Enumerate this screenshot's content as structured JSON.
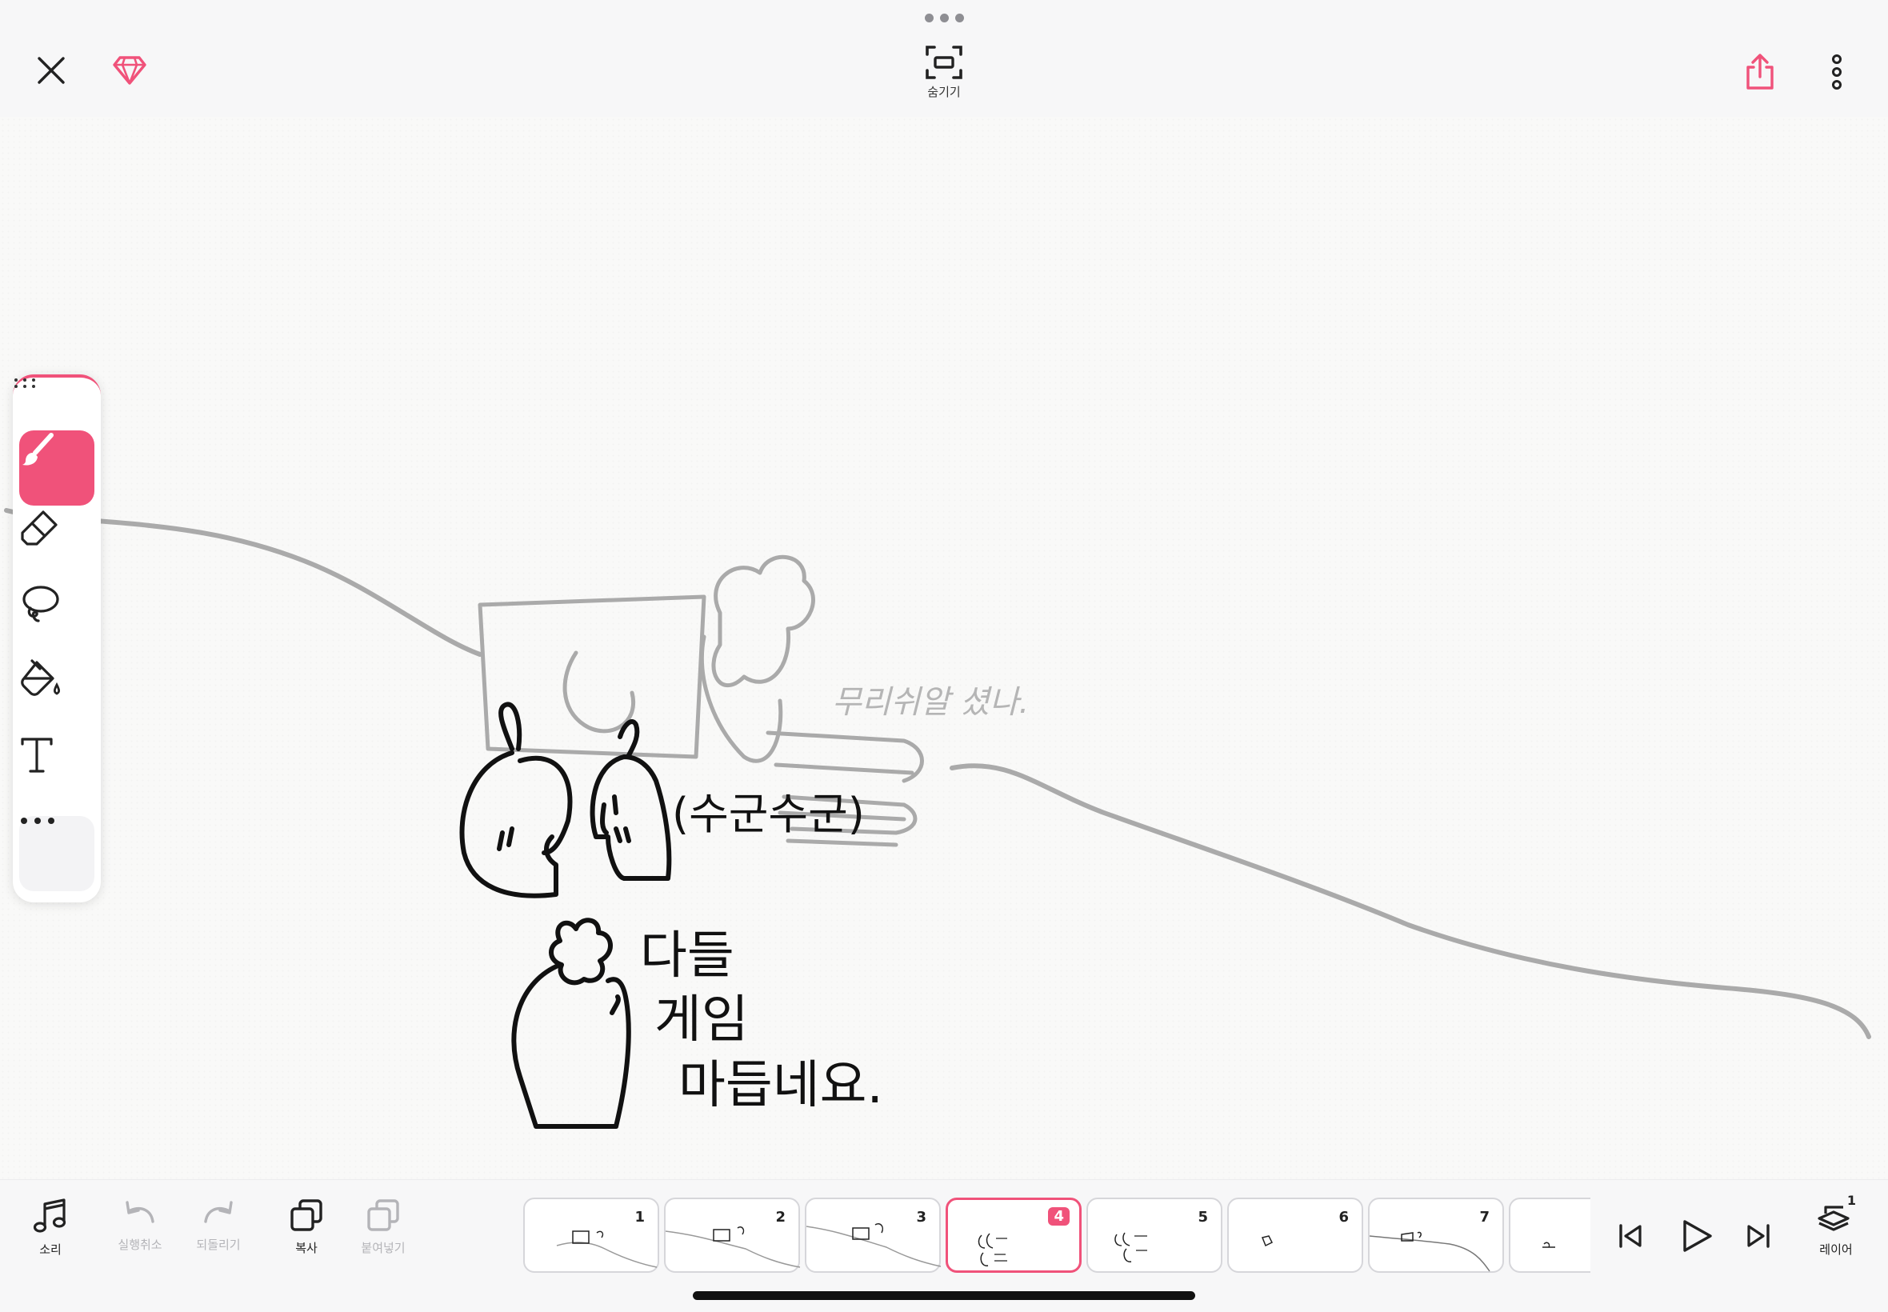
{
  "topbar": {
    "hide_label": "숨기기"
  },
  "drawing_text": {
    "line1": "(수군수군)",
    "line2": "다들",
    "line3": "게임",
    "line4": "마듭네요.",
    "ghost_text": "무리쉬알 셨나."
  },
  "bottom": {
    "sound_label": "소리",
    "undo_label": "실행취소",
    "redo_label": "되돌리기",
    "copy_label": "복사",
    "paste_label": "붙여넣기",
    "layer_label": "레이어",
    "layer_count": "1",
    "frames": [
      {
        "num": "1"
      },
      {
        "num": "2"
      },
      {
        "num": "3"
      },
      {
        "num": "4"
      },
      {
        "num": "5"
      },
      {
        "num": "6"
      },
      {
        "num": "7"
      },
      {
        "num": ""
      }
    ]
  },
  "colors": {
    "accent": "#f0527a",
    "ink": "#111111",
    "onion": "#aaaaaa"
  }
}
